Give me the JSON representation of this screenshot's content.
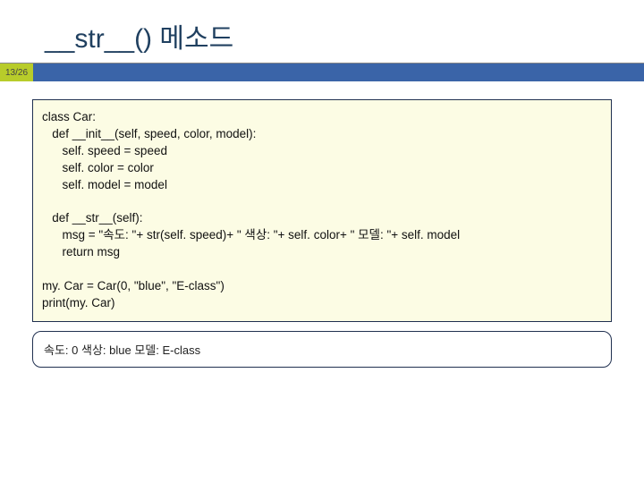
{
  "header": {
    "title": "__str__() 메소드"
  },
  "pagenum": "13/26",
  "code": {
    "line1": "class Car:",
    "line2": "   def __init__(self, speed, color, model):",
    "line3": "      self. speed = speed",
    "line4": "      self. color = color",
    "line5": "      self. model = model",
    "line6": "",
    "line7": "   def __str__(self):",
    "line8": "      msg = \"속도: \"+ str(self. speed)+ \" 색상: \"+ self. color+ \" 모델: \"+ self. model",
    "line9": "      return msg",
    "line10": "",
    "line11": "my. Car = Car(0, \"blue\", \"E-class\")",
    "line12": "print(my. Car)"
  },
  "output": "속도: 0 색상: blue 모델: E-class"
}
